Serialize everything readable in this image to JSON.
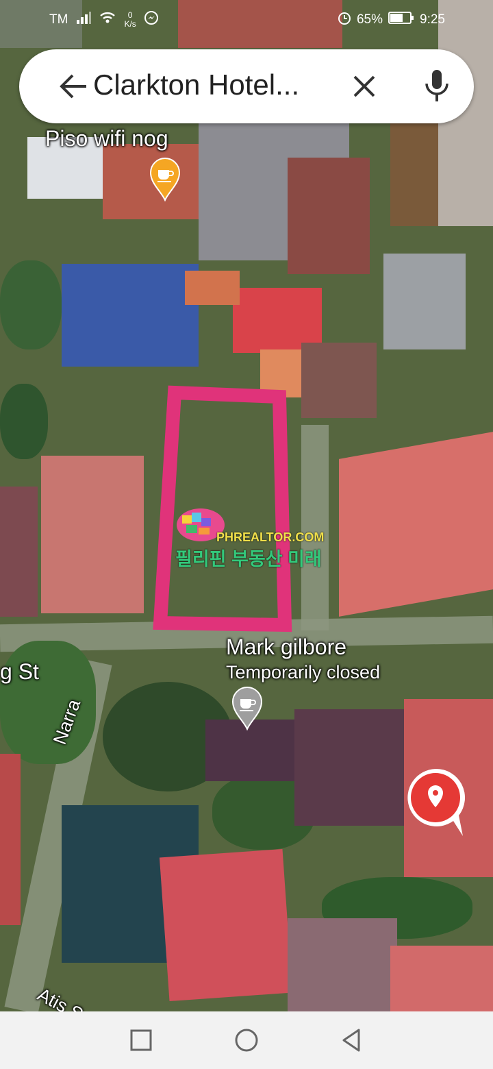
{
  "status_bar": {
    "carrier": "TM",
    "net_speed_value": "0",
    "net_speed_unit": "K/s",
    "battery": "65%",
    "time": "9:25"
  },
  "search": {
    "query": "Clarkton Hotel..."
  },
  "map": {
    "labels": {
      "place_top": "Piso wifi nog",
      "place_mid": "Mark gilbore",
      "place_mid_status": "Temporarily closed",
      "street_st": "g St",
      "street_narra": "Narra",
      "street_atis": "Atis S"
    },
    "watermark": {
      "site": "PHREALTOR.COM",
      "tagline": "필리핀 부동산 미래"
    },
    "outline_color": "#e0337a",
    "cafe_pin_color": "#f5a623",
    "closed_pin_color": "#9e9e9e",
    "fab_color": "#e53935"
  },
  "icons": {
    "back": "arrow-left-icon",
    "clear": "close-icon",
    "mic": "microphone-icon",
    "location": "location-pin-icon",
    "nav_back": "triangle-back-icon",
    "nav_home": "circle-home-icon",
    "nav_recents": "square-recents-icon"
  }
}
